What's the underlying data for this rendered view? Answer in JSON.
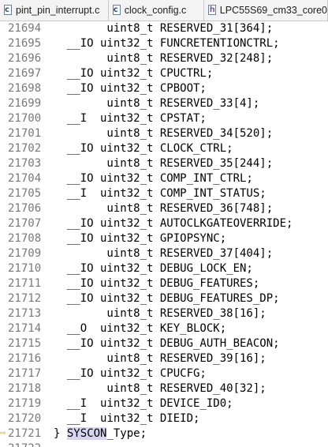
{
  "tabs": [
    {
      "label": "pint_pin_interrupt.c",
      "icon": "c-file-icon"
    },
    {
      "label": "clock_config.c",
      "icon": "c-file-icon"
    },
    {
      "label": "LPC55S69_cm33_core0",
      "icon": "header-file-icon"
    }
  ],
  "lines": [
    {
      "num": "21694",
      "code": "        uint8_t RESERVED_31[364];"
    },
    {
      "num": "21695",
      "code": "  __IO uint32_t FUNCRETENTIONCTRL;"
    },
    {
      "num": "21696",
      "code": "        uint8_t RESERVED_32[248];"
    },
    {
      "num": "21697",
      "code": "  __IO uint32_t CPUCTRL;"
    },
    {
      "num": "21698",
      "code": "  __IO uint32_t CPBOOT;"
    },
    {
      "num": "21699",
      "code": "        uint8_t RESERVED_33[4];"
    },
    {
      "num": "21700",
      "code": "  __I  uint32_t CPSTAT;"
    },
    {
      "num": "21701",
      "code": "        uint8_t RESERVED_34[520];"
    },
    {
      "num": "21702",
      "code": "  __IO uint32_t CLOCK_CTRL;"
    },
    {
      "num": "21703",
      "code": "        uint8_t RESERVED_35[244];"
    },
    {
      "num": "21704",
      "code": "  __IO uint32_t COMP_INT_CTRL;"
    },
    {
      "num": "21705",
      "code": "  __I  uint32_t COMP_INT_STATUS;"
    },
    {
      "num": "21706",
      "code": "        uint8_t RESERVED_36[748];"
    },
    {
      "num": "21707",
      "code": "  __IO uint32_t AUTOCLKGATEOVERRIDE;"
    },
    {
      "num": "21708",
      "code": "  __IO uint32_t GPIOPSYNC;"
    },
    {
      "num": "21709",
      "code": "        uint8_t RESERVED_37[404];"
    },
    {
      "num": "21710",
      "code": "  __IO uint32_t DEBUG_LOCK_EN;"
    },
    {
      "num": "21711",
      "code": "  __IO uint32_t DEBUG_FEATURES;"
    },
    {
      "num": "21712",
      "code": "  __IO uint32_t DEBUG_FEATURES_DP;"
    },
    {
      "num": "21713",
      "code": "        uint8_t RESERVED_38[16];"
    },
    {
      "num": "21714",
      "code": "  __O  uint32_t KEY_BLOCK;"
    },
    {
      "num": "21715",
      "code": "  __IO uint32_t DEBUG_AUTH_BEACON;"
    },
    {
      "num": "21716",
      "code": "        uint8_t RESERVED_39[16];"
    },
    {
      "num": "21717",
      "code": "  __IO uint32_t CPUCFG;"
    },
    {
      "num": "21718",
      "code": "        uint8_t RESERVED_40[32];"
    },
    {
      "num": "21719",
      "code": "  __I  uint32_t DEVICE_ID0;"
    },
    {
      "num": "21720",
      "code": "  __I  uint32_t DIEID;"
    },
    {
      "num": "21721",
      "code_prefix": "} ",
      "code_selected": "SYSCON",
      "code_suffix": "_Type;"
    },
    {
      "num": "21722",
      "code": ""
    }
  ],
  "colors": {
    "line_number": "#787878",
    "selection": "#d5d5f0",
    "marker": "#c99a00"
  }
}
